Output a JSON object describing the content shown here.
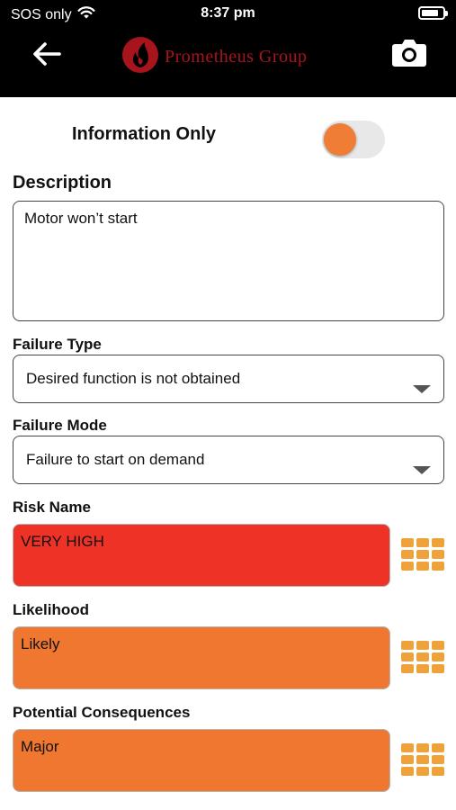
{
  "status_bar": {
    "carrier": "SOS only",
    "time": "8:37 pm",
    "battery_level": 0.8,
    "wifi_icon": "wifi-icon"
  },
  "header": {
    "back_icon": "arrow-left-icon",
    "logo_text": "Prometheus Group",
    "camera_icon": "camera-icon",
    "background": "#000000",
    "brand_color": "#a8141c"
  },
  "form": {
    "info_only": {
      "label": "Information Only",
      "on": true,
      "accent": "#ef7d35"
    },
    "description": {
      "label": "Description",
      "value": "Motor won’t start"
    },
    "failure_type": {
      "label": "Failure Type",
      "value": "Desired function is not obtained"
    },
    "failure_mode": {
      "label": "Failure Mode",
      "value": "Failure to start on demand"
    },
    "risk_name": {
      "label": "Risk Name",
      "value": "VERY HIGH",
      "color": "#ef3226"
    },
    "likelihood": {
      "label": "Likelihood",
      "value": "Likely",
      "color": "#ef7730"
    },
    "consequences": {
      "label": "Potential Consequences",
      "value": "Major",
      "color": "#ef7730"
    },
    "matrix_icon": "grid-icon",
    "matrix_color": "#efa23a"
  }
}
